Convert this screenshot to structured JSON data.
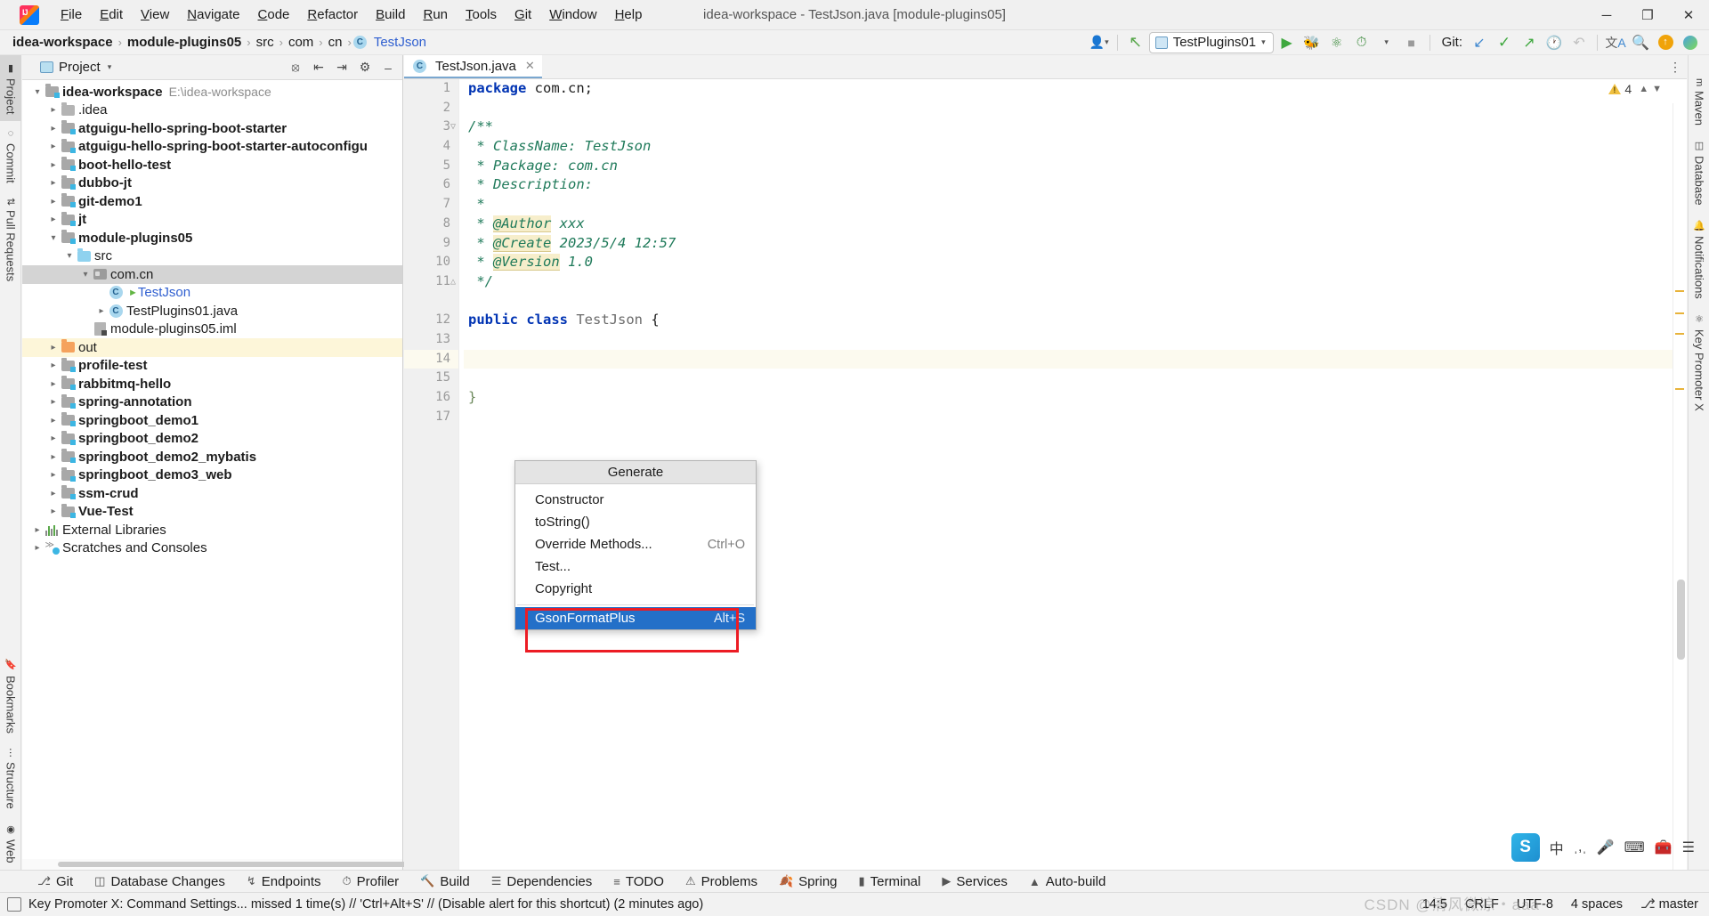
{
  "titlebar": {
    "app_icon": "intellij-idea-icon",
    "menus": [
      "File",
      "Edit",
      "View",
      "Navigate",
      "Code",
      "Refactor",
      "Build",
      "Run",
      "Tools",
      "Git",
      "Window",
      "Help"
    ],
    "window_title": "idea-workspace - TestJson.java [module-plugins05]",
    "minimize": "─",
    "maximize": "❐",
    "close": "✕"
  },
  "navbar": {
    "breadcrumbs": [
      "idea-workspace",
      "module-plugins05",
      "src",
      "com",
      "cn",
      "TestJson"
    ],
    "separator": "›",
    "run_config": "TestPlugins01",
    "git_label": "Git:",
    "icons": {
      "user": "user-icon",
      "updates": "update-project-icon",
      "run": "run-icon",
      "debug": "debug-icon",
      "coverage": "run-with-coverage-icon",
      "profile": "profiler-icon",
      "stop": "stop-icon",
      "pull": "git-pull-icon",
      "commit": "git-commit-icon",
      "push": "git-push-icon",
      "history": "git-history-icon",
      "rollback": "git-rollback-icon",
      "translate": "translate-icon",
      "search": "search-everywhere-icon",
      "update": "update-available-icon",
      "ide": "ide-assistant-icon"
    }
  },
  "left_strip": {
    "top_tabs": [
      "Project",
      "Commit",
      "Pull Requests"
    ],
    "bottom_tabs": [
      "Bookmarks",
      "Structure",
      "Web"
    ],
    "active": "Project"
  },
  "right_strip": {
    "tabs": [
      "Maven",
      "Database",
      "Notifications",
      "Key Promoter X"
    ]
  },
  "project_panel": {
    "title": "Project",
    "header_icons": [
      "locate-icon",
      "expand-all-icon",
      "collapse-all-icon",
      "settings-icon",
      "hide-icon"
    ],
    "tree": [
      {
        "depth": 0,
        "arrow": "down",
        "icon": "module-folder",
        "label": "idea-workspace",
        "bold": true,
        "note": "E:\\idea-workspace"
      },
      {
        "depth": 1,
        "arrow": "right",
        "icon": "folder",
        "label": ".idea",
        "bold": false
      },
      {
        "depth": 1,
        "arrow": "right",
        "icon": "module-folder",
        "label": "atguigu-hello-spring-boot-starter",
        "bold": true
      },
      {
        "depth": 1,
        "arrow": "right",
        "icon": "module-folder",
        "label": "atguigu-hello-spring-boot-starter-autoconfigu",
        "bold": true
      },
      {
        "depth": 1,
        "arrow": "right",
        "icon": "module-folder",
        "label": "boot-hello-test",
        "bold": true
      },
      {
        "depth": 1,
        "arrow": "right",
        "icon": "module-folder",
        "label": "dubbo-jt",
        "bold": true
      },
      {
        "depth": 1,
        "arrow": "right",
        "icon": "module-folder",
        "label": "git-demo1",
        "bold": true
      },
      {
        "depth": 1,
        "arrow": "right",
        "icon": "module-folder",
        "label": "jt",
        "bold": true
      },
      {
        "depth": 1,
        "arrow": "down",
        "icon": "module-folder",
        "label": "module-plugins05",
        "bold": true
      },
      {
        "depth": 2,
        "arrow": "down",
        "icon": "source-folder",
        "label": "src",
        "bold": false
      },
      {
        "depth": 3,
        "arrow": "down",
        "icon": "package",
        "label": "com.cn",
        "bold": false,
        "state": "selected"
      },
      {
        "depth": 4,
        "arrow": "none",
        "icon": "java-class",
        "label": "TestJson",
        "bold": false,
        "link": true,
        "runnable": true
      },
      {
        "depth": 4,
        "arrow": "right",
        "icon": "java-class-run",
        "label": "TestPlugins01.java",
        "bold": false
      },
      {
        "depth": 3,
        "arrow": "none",
        "icon": "iml-file",
        "label": "module-plugins05.iml",
        "bold": false
      },
      {
        "depth": 1,
        "arrow": "right",
        "icon": "out-folder",
        "label": "out",
        "bold": false,
        "state": "highlight"
      },
      {
        "depth": 1,
        "arrow": "right",
        "icon": "module-folder",
        "label": "profile-test",
        "bold": true
      },
      {
        "depth": 1,
        "arrow": "right",
        "icon": "module-folder",
        "label": "rabbitmq-hello",
        "bold": true
      },
      {
        "depth": 1,
        "arrow": "right",
        "icon": "module-folder",
        "label": "spring-annotation",
        "bold": true
      },
      {
        "depth": 1,
        "arrow": "right",
        "icon": "module-folder",
        "label": "springboot_demo1",
        "bold": true
      },
      {
        "depth": 1,
        "arrow": "right",
        "icon": "module-folder",
        "label": "springboot_demo2",
        "bold": true
      },
      {
        "depth": 1,
        "arrow": "right",
        "icon": "module-folder",
        "label": "springboot_demo2_mybatis",
        "bold": true
      },
      {
        "depth": 1,
        "arrow": "right",
        "icon": "module-folder",
        "label": "springboot_demo3_web",
        "bold": true
      },
      {
        "depth": 1,
        "arrow": "right",
        "icon": "module-folder",
        "label": "ssm-crud",
        "bold": true
      },
      {
        "depth": 1,
        "arrow": "right",
        "icon": "module-folder",
        "label": "Vue-Test",
        "bold": true
      },
      {
        "depth": 0,
        "arrow": "right",
        "icon": "external-libraries",
        "label": "External Libraries",
        "bold": false
      },
      {
        "depth": 0,
        "arrow": "right",
        "icon": "scratches",
        "label": "Scratches and Consoles",
        "bold": false
      }
    ]
  },
  "editor": {
    "tab": {
      "label": "TestJson.java",
      "close": "✕",
      "icon": "java-class-icon"
    },
    "warning_count": "4",
    "lines": [
      {
        "n": "1",
        "tokens": [
          {
            "t": "package ",
            "c": "kw"
          },
          {
            "t": "com.cn;",
            "c": "plain"
          }
        ]
      },
      {
        "n": "2",
        "tokens": []
      },
      {
        "n": "3",
        "tokens": [
          {
            "t": "/**",
            "c": "cmt"
          }
        ],
        "fold": "start"
      },
      {
        "n": "4",
        "tokens": [
          {
            "t": " * ClassName: TestJson",
            "c": "cmt"
          }
        ]
      },
      {
        "n": "5",
        "tokens": [
          {
            "t": " * Package: com.cn",
            "c": "cmt"
          }
        ]
      },
      {
        "n": "6",
        "tokens": [
          {
            "t": " * Description:",
            "c": "cmt"
          }
        ]
      },
      {
        "n": "7",
        "tokens": [
          {
            "t": " *",
            "c": "cmt"
          }
        ]
      },
      {
        "n": "8",
        "tokens": [
          {
            "t": " * ",
            "c": "cmt"
          },
          {
            "t": "@Author",
            "c": "tagh"
          },
          {
            "t": " xxx",
            "c": "cmt"
          }
        ]
      },
      {
        "n": "9",
        "tokens": [
          {
            "t": " * ",
            "c": "cmt"
          },
          {
            "t": "@Create",
            "c": "tagh"
          },
          {
            "t": " 2023/5/4 12:57",
            "c": "cmt"
          }
        ]
      },
      {
        "n": "10",
        "tokens": [
          {
            "t": " * ",
            "c": "cmt"
          },
          {
            "t": "@Version",
            "c": "tagh"
          },
          {
            "t": " 1.0",
            "c": "cmt"
          }
        ]
      },
      {
        "n": "11",
        "tokens": [
          {
            "t": " */",
            "c": "cmt"
          }
        ],
        "fold": "end"
      },
      {
        "n": "",
        "tokens": []
      },
      {
        "n": "12",
        "tokens": [
          {
            "t": "public class ",
            "c": "kw"
          },
          {
            "t": "TestJson ",
            "c": "cls"
          },
          {
            "t": "{",
            "c": "plain"
          }
        ]
      },
      {
        "n": "13",
        "tokens": []
      },
      {
        "n": "14",
        "tokens": [],
        "caret": true
      },
      {
        "n": "15",
        "tokens": []
      },
      {
        "n": "16",
        "tokens": [
          {
            "t": "}",
            "c": "brace"
          }
        ]
      },
      {
        "n": "17",
        "tokens": []
      }
    ]
  },
  "generate_popup": {
    "title": "Generate",
    "items": [
      {
        "label": "Constructor",
        "shortcut": ""
      },
      {
        "label": "toString()",
        "shortcut": ""
      },
      {
        "label": "Override Methods...",
        "shortcut": "Ctrl+O"
      },
      {
        "label": "Test...",
        "shortcut": ""
      },
      {
        "label": "Copyright",
        "shortcut": ""
      },
      {
        "label": "GsonFormatPlus",
        "shortcut": "Alt+S",
        "selected": true
      }
    ],
    "highlight_color": "#ec1c24",
    "selection_color": "#2470c8"
  },
  "tool_windows": [
    {
      "label": "Git",
      "icon": "git-branch-icon"
    },
    {
      "label": "Database Changes",
      "icon": "database-changes-icon"
    },
    {
      "label": "Endpoints",
      "icon": "endpoints-icon"
    },
    {
      "label": "Profiler",
      "icon": "profiler-icon"
    },
    {
      "label": "Build",
      "icon": "build-hammer-icon"
    },
    {
      "label": "Dependencies",
      "icon": "dependencies-icon"
    },
    {
      "label": "TODO",
      "icon": "todo-list-icon"
    },
    {
      "label": "Problems",
      "icon": "problems-icon"
    },
    {
      "label": "Spring",
      "icon": "spring-leaf-icon"
    },
    {
      "label": "Terminal",
      "icon": "terminal-icon"
    },
    {
      "label": "Services",
      "icon": "services-icon"
    },
    {
      "label": "Auto-build",
      "icon": "auto-build-icon"
    }
  ],
  "status_bar": {
    "message": "Key Promoter X: Command Settings... missed 1 time(s) // 'Ctrl+Alt+S' // (Disable alert for this shortcut) (2 minutes ago)",
    "caret_position": "14:5",
    "line_separator": "CRLF",
    "encoding": "UTF-8",
    "indent": "4 spaces",
    "branch": "master"
  },
  "ime_bar": {
    "logo": "sogou-ime-icon",
    "items": [
      "中",
      "ˌ,ˌ",
      "mic-icon",
      "keyboard-icon",
      "toolbox-icon",
      "menu-icon"
    ]
  },
  "watermark": "CSDN @清风微凉・aaa"
}
